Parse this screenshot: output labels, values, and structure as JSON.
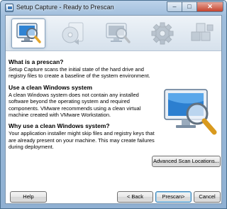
{
  "window": {
    "title": "Setup Capture - Ready to Prescan",
    "minimize_glyph": "–",
    "maximize_glyph": "□",
    "close_glyph": "✕"
  },
  "steps": [
    {
      "name": "prescan-step",
      "icon": "monitor-magnifier-icon",
      "active": true
    },
    {
      "name": "install-step",
      "icon": "disc-install-icon",
      "active": false
    },
    {
      "name": "postscan-step",
      "icon": "monitor-magnifier-icon",
      "active": false
    },
    {
      "name": "configure-step",
      "icon": "gear-icon",
      "active": false
    },
    {
      "name": "build-step",
      "icon": "package-boxes-icon",
      "active": false
    }
  ],
  "sections": [
    {
      "title": "What is a prescan?",
      "lines": [
        "Setup Capture scans the initial state of the hard drive and",
        "registry files to create a baseline of the system environment."
      ]
    },
    {
      "title": "Use a clean Windows system",
      "lines": [
        "A clean Windows system does not contain any installed",
        "software beyond the operating system and required",
        "components. VMware recommends using a clean virtual",
        "machine created with VMware Workstation."
      ]
    },
    {
      "title": "Why use a clean Windows system?",
      "lines": [
        "Your application installer might skip files and registry keys that",
        "are already present on your machine. This may create failures",
        "during deployment."
      ]
    }
  ],
  "buttons": {
    "advanced": "Advanced Scan Locations...",
    "help": "Help",
    "back": "< Back",
    "prescan": "Prescan>",
    "cancel": "Cancel"
  },
  "colors": {
    "title_bar": "#9fbddb",
    "banner": "#d6e1ec",
    "accent": "#3b78b8",
    "close": "#c4432d"
  }
}
